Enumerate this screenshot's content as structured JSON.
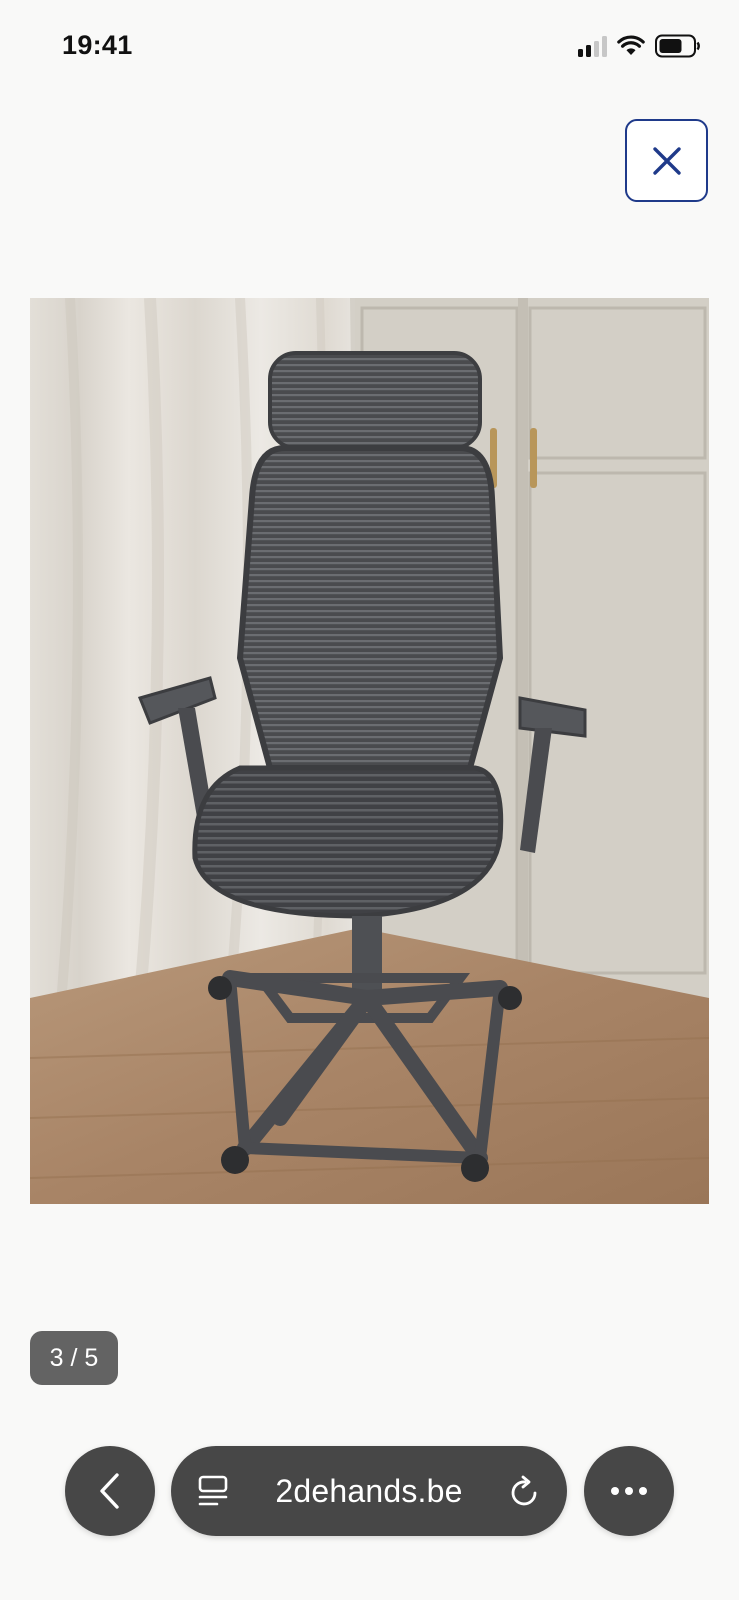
{
  "status_bar": {
    "time": "19:41",
    "icons": [
      "signal-icon",
      "wifi-icon",
      "battery-icon"
    ]
  },
  "close_button": {
    "icon": "close-icon",
    "color": "#1f3a8a"
  },
  "photo": {
    "subject": ""
  },
  "gallery": {
    "counter": "3 / 5",
    "current": 3,
    "total": 5
  },
  "browser_bar": {
    "back_icon": "chevron-left-icon",
    "reader_icon": "reader-icon",
    "url": "2dehands.be",
    "reload_icon": "reload-icon",
    "more_icon": "more-icon",
    "bg": "#474747"
  }
}
